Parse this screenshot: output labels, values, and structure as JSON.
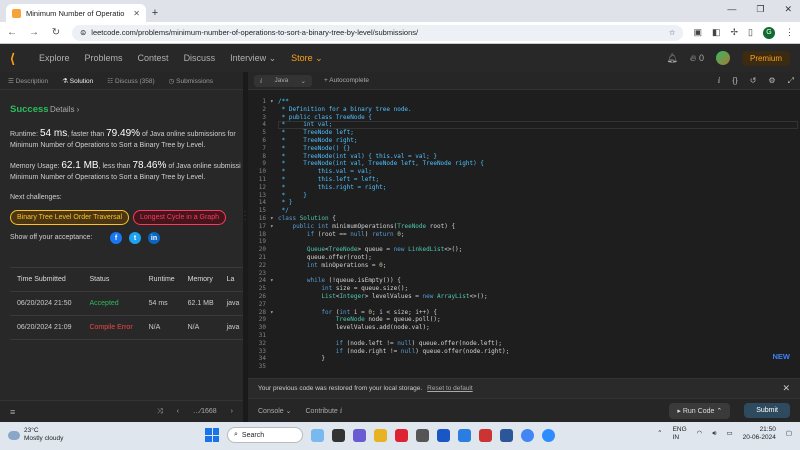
{
  "browser": {
    "tab_title": "Minimum Number of Operatio",
    "url": "leetcode.com/problems/minimum-number-of-operations-to-sort-a-binary-tree-by-level/submissions/",
    "profile_initial": "G"
  },
  "nav": {
    "links": [
      "Explore",
      "Problems",
      "Contest",
      "Discuss",
      "Interview ⌄",
      "Store ⌄"
    ],
    "fire_count": "0",
    "premium": "Premium"
  },
  "left_tabs": [
    "Description",
    "Solution",
    "Discuss (358)",
    "Submissions"
  ],
  "result": {
    "status": "Success",
    "details": "Details ›",
    "runtime_line1_pre": "Runtime: ",
    "runtime_value": "54 ms",
    "runtime_mid": ", faster than ",
    "runtime_pct": "79.49%",
    "runtime_post": " of Java online submissions for",
    "runtime_line2": "Minimum Number of Operations to Sort a Binary Tree by Level.",
    "memory_pre": "Memory Usage: ",
    "memory_value": "62.1 MB",
    "memory_mid": ", less than ",
    "memory_pct": "78.46%",
    "memory_post": " of Java online submissi",
    "memory_line2": "Minimum Number of Operations to Sort a Binary Tree by Level.",
    "next_label": "Next challenges:",
    "challenge1": "Binary Tree Level Order Traversal",
    "challenge2": "Longest Cycle in a Graph",
    "show_off": "Show off your acceptance:"
  },
  "table": {
    "headers": [
      "Time Submitted",
      "Status",
      "Runtime",
      "Memory",
      "La"
    ],
    "rows": [
      [
        "06/20/2024 21:50",
        "Accepted",
        "54 ms",
        "62.1 MB",
        "java"
      ],
      [
        "06/20/2024 21:09",
        "Compile Error",
        "N/A",
        "N/A",
        "java"
      ]
    ]
  },
  "left_bottom": {
    "pager": "⁄1668"
  },
  "editor": {
    "language": "Java",
    "autocomplete": "Autocomplete",
    "new_badge": "NEW",
    "lines": [
      [
        "1",
        "/**"
      ],
      [
        "2",
        " * Definition for a binary tree node."
      ],
      [
        "3",
        " * public class TreeNode {"
      ],
      [
        "4",
        " *     int val;"
      ],
      [
        "5",
        " *     TreeNode left;"
      ],
      [
        "6",
        " *     TreeNode right;"
      ],
      [
        "7",
        " *     TreeNode() {}"
      ],
      [
        "8",
        " *     TreeNode(int val) { this.val = val; }"
      ],
      [
        "9",
        " *     TreeNode(int val, TreeNode left, TreeNode right) {"
      ],
      [
        "10",
        " *         this.val = val;"
      ],
      [
        "11",
        " *         this.left = left;"
      ],
      [
        "12",
        " *         this.right = right;"
      ],
      [
        "13",
        " *     }"
      ],
      [
        "14",
        " * }"
      ],
      [
        "15",
        " */"
      ],
      [
        "16",
        "class Solution {"
      ],
      [
        "17",
        "    public int minimumOperations(TreeNode root) {"
      ],
      [
        "18",
        "        if (root == null) return 0;"
      ],
      [
        "19",
        ""
      ],
      [
        "20",
        "        Queue<TreeNode> queue = new LinkedList<>();"
      ],
      [
        "21",
        "        queue.offer(root);"
      ],
      [
        "22",
        "        int minOperations = 0;"
      ],
      [
        "23",
        ""
      ],
      [
        "24",
        "        while (!queue.isEmpty()) {"
      ],
      [
        "25",
        "            int size = queue.size();"
      ],
      [
        "26",
        "            List<Integer> levelValues = new ArrayList<>();"
      ],
      [
        "27",
        ""
      ],
      [
        "28",
        "            for (int i = 0; i < size; i++) {"
      ],
      [
        "29",
        "                TreeNode node = queue.poll();"
      ],
      [
        "30",
        "                levelValues.add(node.val);"
      ],
      [
        "31",
        ""
      ],
      [
        "32",
        "                if (node.left != null) queue.offer(node.left);"
      ],
      [
        "33",
        "                if (node.right != null) queue.offer(node.right);"
      ],
      [
        "34",
        "            }"
      ],
      [
        "35",
        ""
      ]
    ],
    "restore_msg": "Your previous code was restored from your local storage.",
    "reset_link": "Reset to default",
    "console": "Console ⌄",
    "contribute": "Contribute ⅈ",
    "run": "Run Code ⌃",
    "submit": "Submit"
  },
  "taskbar": {
    "temp": "23°C",
    "weather": "Mostly cloudy",
    "search": "Search",
    "lang1": "ENG",
    "lang2": "IN",
    "time": "21:50",
    "date": "20-06-2024"
  }
}
